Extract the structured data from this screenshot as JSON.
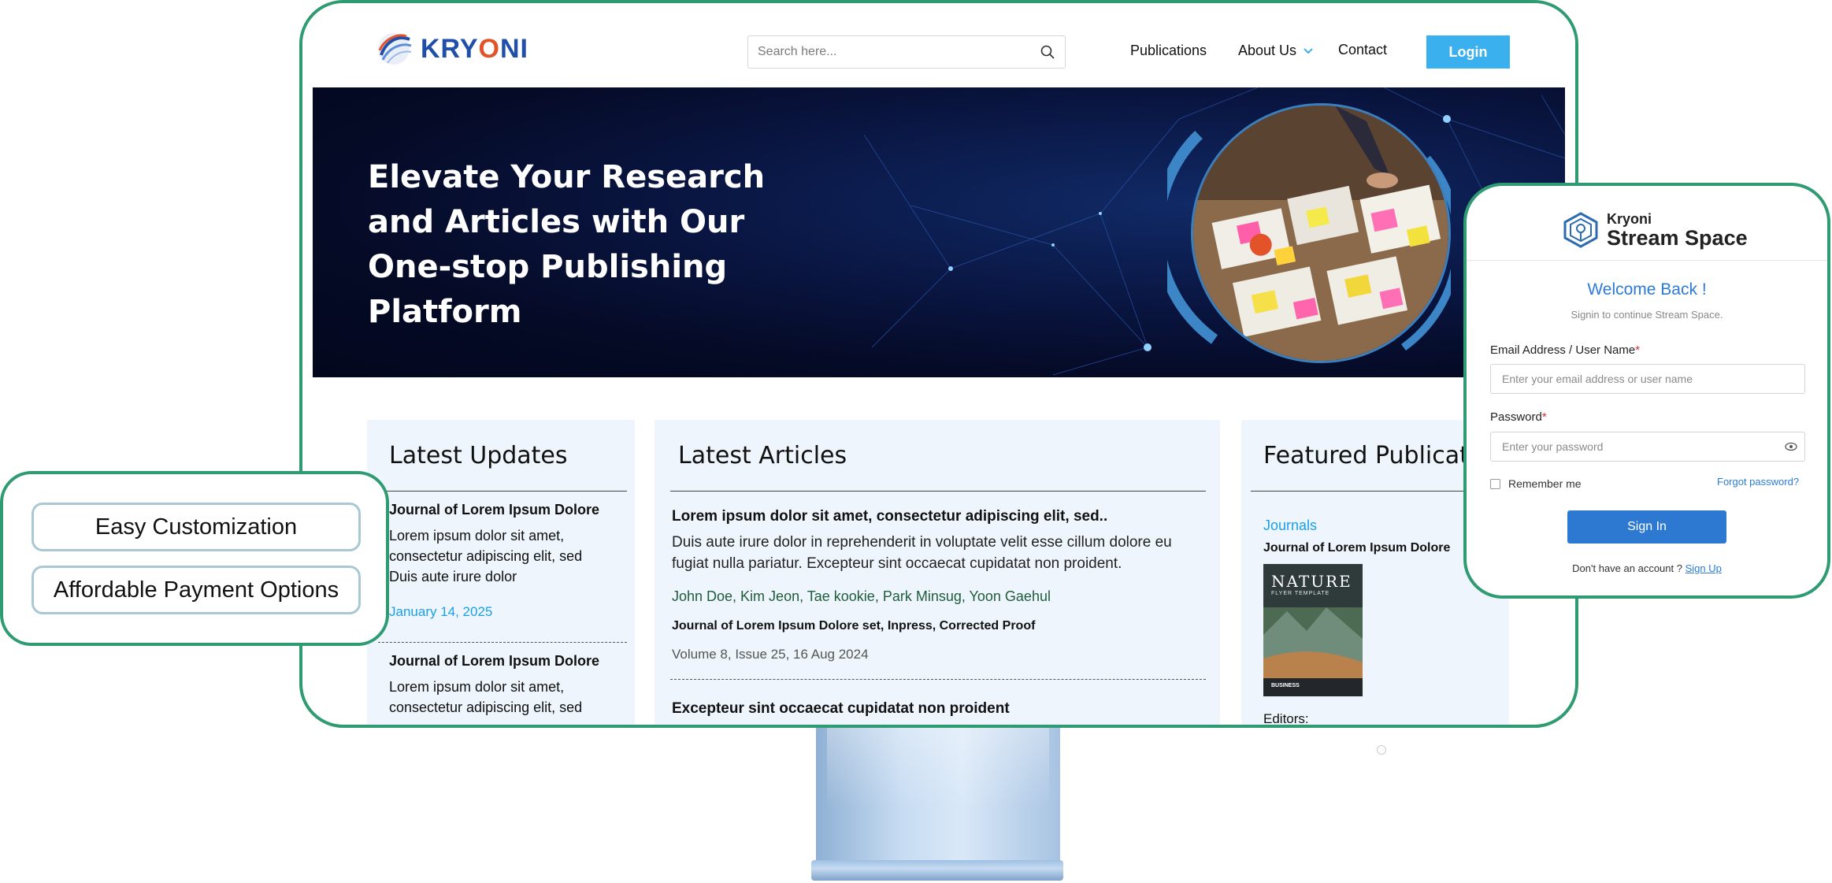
{
  "header": {
    "brand": "KRYONI",
    "search": {
      "placeholder": "Search here..."
    },
    "nav": {
      "publications": "Publications",
      "about": "About Us",
      "contact": "Contact"
    },
    "login_label": "Login"
  },
  "hero": {
    "title": "Elevate Your Research and Articles with Our One-stop Publishing Platform"
  },
  "latest_updates": {
    "heading": "Latest Updates",
    "items": [
      {
        "title": "Journal of Lorem Ipsum Dolore",
        "body": "Lorem ipsum dolor sit amet, consectetur adipiscing elit, sed Duis aute irure dolor",
        "date": "January 14, 2025"
      },
      {
        "title": "Journal of Lorem Ipsum Dolore",
        "body": "Lorem ipsum dolor sit amet, consectetur adipiscing elit, sed"
      }
    ]
  },
  "latest_articles": {
    "heading": "Latest Articles",
    "items": [
      {
        "title": "Lorem ipsum dolor sit amet, consectetur adipiscing elit, sed..",
        "body": "Duis aute irure dolor in reprehenderit in voluptate velit esse cillum dolore eu fugiat nulla pariatur. Excepteur sint occaecat cupidatat non proident.",
        "authors": "John Doe, Kim Jeon, Tae kookie, Park Minsug, Yoon Gaehul",
        "journal": "Journal of Lorem Ipsum Dolore set, Inpress, Corrected Proof",
        "volume": "Volume 8, Issue 25, 16 Aug 2024"
      },
      {
        "title": "Excepteur sint occaecat cupidatat non proident"
      }
    ]
  },
  "featured": {
    "heading": "Featured Publications",
    "category": "Journals",
    "journal": "Journal of Lorem Ipsum Dolore",
    "cover": {
      "title": "NATURE",
      "subtitle": "FLYER TEMPLATE",
      "footer": "BUSINESS"
    },
    "editors_label": "Editors:"
  },
  "features": {
    "items": [
      "Easy Customization",
      "Affordable Payment Options"
    ]
  },
  "login_card": {
    "brand_small": "Kryoni",
    "brand_big": "Stream Space",
    "welcome": "Welcome Back !",
    "subtitle": "Signin to continue Stream Space.",
    "email_label": "Email Address / User Name",
    "email_placeholder": "Enter your email address or user name",
    "password_label": "Password",
    "password_placeholder": "Enter your password",
    "required_mark": "*",
    "remember_label": "Remember me",
    "forgot_label": "Forgot password?",
    "signin_label": "Sign In",
    "no_account_text": "Don't have an account ?",
    "signup_label": "Sign Up"
  },
  "colors": {
    "accent_green": "#2f9b72",
    "login_blue": "#3bb0ef",
    "link_blue": "#2b7bd6",
    "date_blue": "#1aa0e6",
    "brand_blue": "#1f4fa8",
    "brand_orange": "#e2532a"
  }
}
